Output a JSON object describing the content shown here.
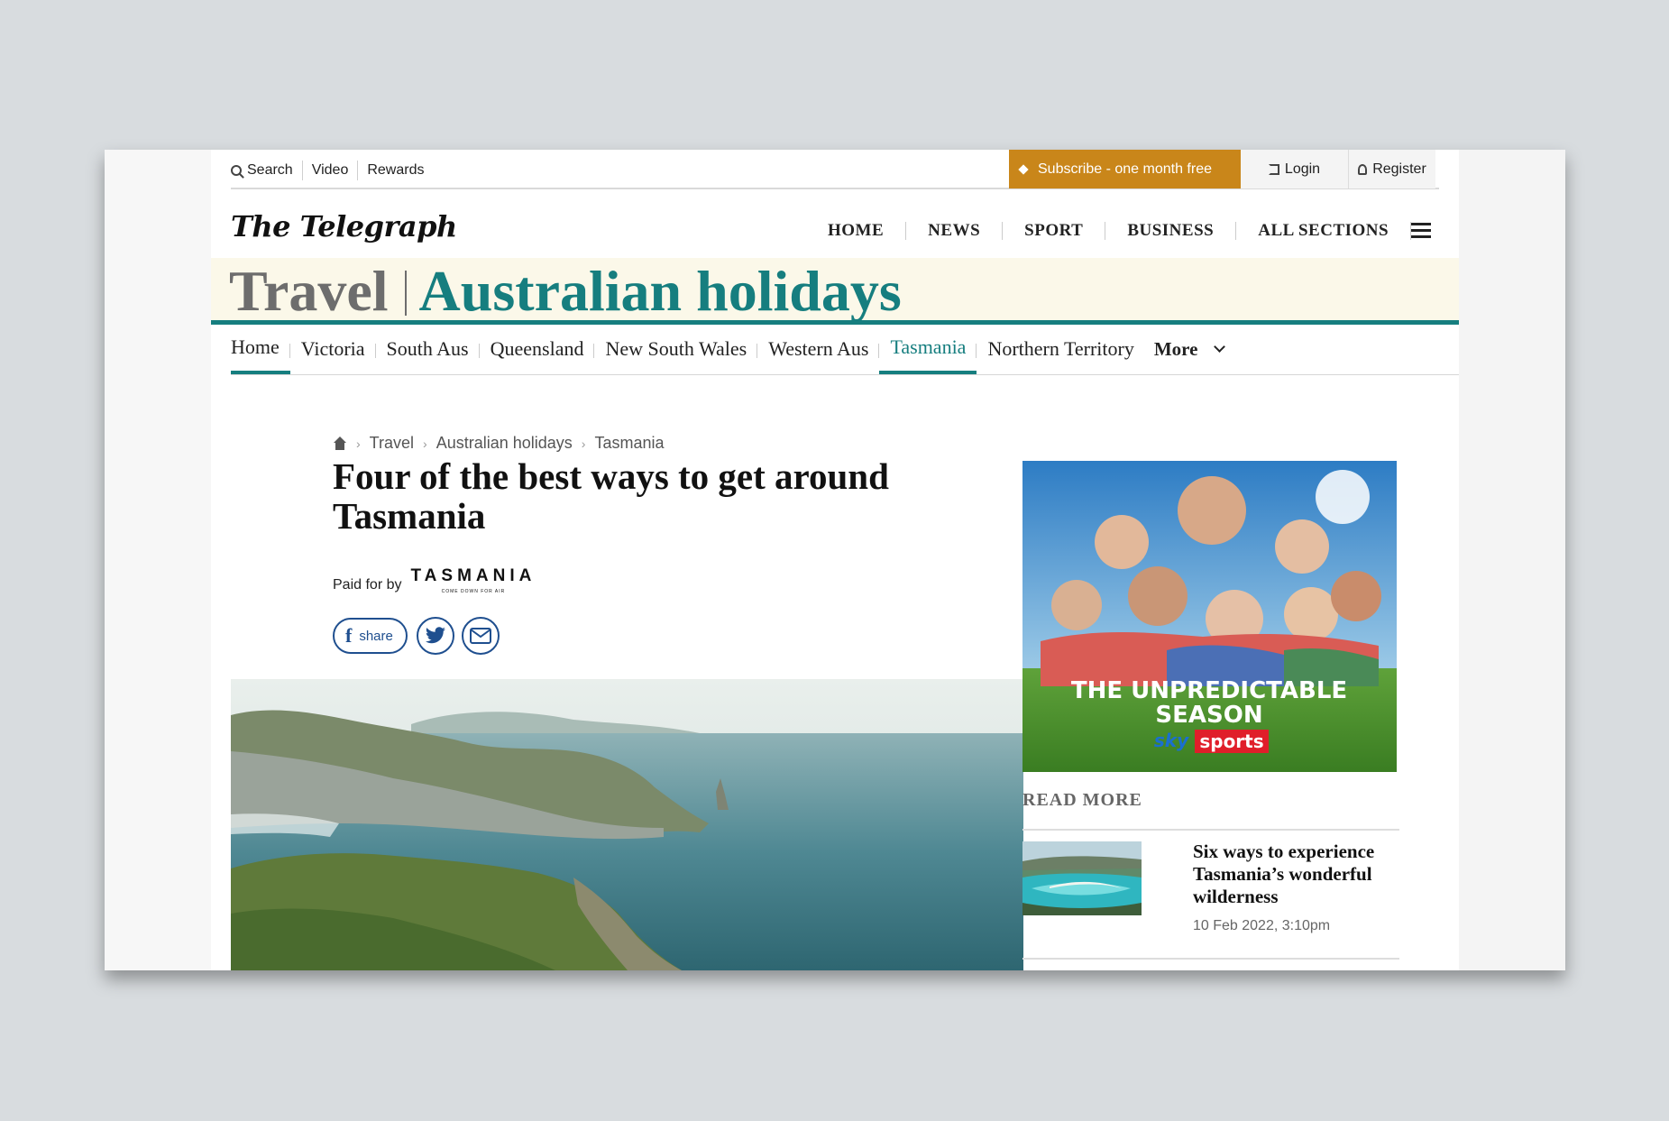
{
  "util": {
    "search": "Search",
    "video": "Video",
    "rewards": "Rewards",
    "subscribe": "Subscribe - one month free",
    "login": "Login",
    "register": "Register"
  },
  "masthead": {
    "logo": "The Telegraph",
    "nav": [
      "HOME",
      "NEWS",
      "SPORT",
      "BUSINESS",
      "ALL SECTIONS"
    ]
  },
  "banner": {
    "section": "Travel",
    "subsection": "Australian holidays"
  },
  "subnav": {
    "items": [
      "Home",
      "Victoria",
      "South Aus",
      "Queensland",
      "New South Wales",
      "Western Aus",
      "Tasmania",
      "Northern Territory"
    ],
    "more": "More"
  },
  "breadcrumb": [
    "Travel",
    "Australian holidays",
    "Tasmania"
  ],
  "article": {
    "headline": "Four of the best ways to get around Tasmania",
    "paid_for_by": "Paid for by",
    "sponsor": "TASMANIA",
    "sponsor_tagline": "COME DOWN FOR AIR",
    "share": "share"
  },
  "ad": {
    "line1": "THE UNPREDICTABLE",
    "line2": "SEASON",
    "brand1": "sky",
    "brand2": "sports"
  },
  "read_more": {
    "heading": "READ MORE",
    "title": "Six ways to experience Tasmania’s wonderful wilderness",
    "date": "10 Feb 2022, 3:10pm"
  },
  "colors": {
    "teal": "#167e7f",
    "gold": "#c9861a",
    "share_blue": "#1f4f8f"
  }
}
